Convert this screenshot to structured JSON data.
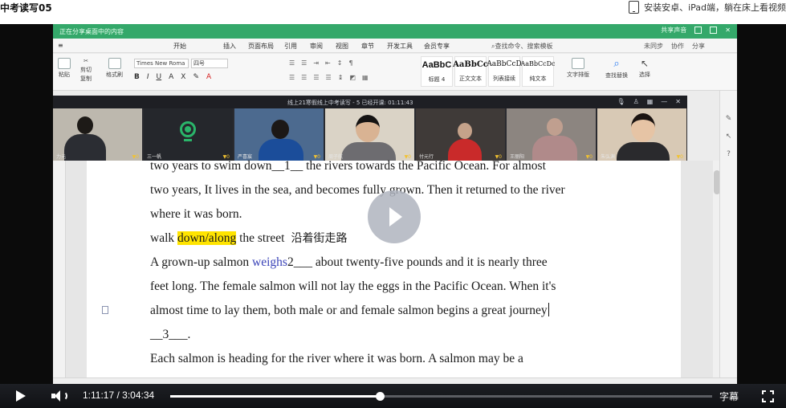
{
  "header": {
    "page_title": "中考读写05",
    "install_text": "安装安卓、iPad端，躺在床上看视频"
  },
  "wps": {
    "share_title": "正在分享桌面中的内容",
    "title_right": [
      "共享声音"
    ],
    "tabs": [
      "开始",
      "插入",
      "页面布局",
      "引用",
      "审阅",
      "视图",
      "章节",
      "开发工具",
      "会员专享"
    ],
    "active_tab": "开始",
    "search_cmd": "查找命令、搜索模板",
    "ribbon_right": [
      "未同步",
      "协作",
      "分享"
    ],
    "font_name": "Times New Roma",
    "font_size": "四号",
    "clipboard": [
      "粘贴",
      "剪切",
      "复制",
      "格式刷"
    ],
    "styles": [
      {
        "sample": "AaBbC",
        "name": "标题 4"
      },
      {
        "sample": "AaBbCc",
        "name": "正文文本"
      },
      {
        "sample": "AaBbCcD",
        "name": "列表接续"
      },
      {
        "sample": "AaBbCcDc",
        "name": "纯文本"
      }
    ],
    "tools": [
      "文字排版",
      "查找替换",
      "选择"
    ]
  },
  "meeting": {
    "title": "线上21寒假线上中考读写 - 5  已经开课: 01:11:43",
    "participants": [
      {
        "name": "力元"
      },
      {
        "name": "三一帆"
      },
      {
        "name": "严喜宸"
      },
      {
        "name": "周子航"
      },
      {
        "name": "付元行"
      },
      {
        "name": "王丽阳"
      },
      {
        "name": "朱弘渊"
      }
    ]
  },
  "document": {
    "lines": [
      {
        "parts": [
          {
            "t": "two years to swim down__1__ the rivers towards the Pacific Ocean. For almost"
          }
        ]
      },
      {
        "parts": [
          {
            "t": "two years, It lives in the sea, and becomes fully grown. Then it returned to the river"
          }
        ]
      },
      {
        "parts": [
          {
            "t": "where it was born."
          }
        ]
      },
      {
        "parts": [
          {
            "t": "walk "
          },
          {
            "t": "down/along",
            "hl": true
          },
          {
            "t": " the street"
          },
          {
            "t": "沿着街走路",
            "cjk": true
          }
        ]
      },
      {
        "parts": [
          {
            "t": "A grown-up salmon "
          },
          {
            "t": "weighs",
            "blue": true
          },
          {
            "t": "2___ about twenty-five pounds and it is nearly three"
          }
        ]
      },
      {
        "parts": [
          {
            "t": "feet long. The female salmon will not lay the eggs in the Pacific Ocean. When it's"
          }
        ]
      },
      {
        "parts": [
          {
            "t": "almost time to lay them, both male or and female salmon begins a great journey"
          }
        ],
        "cursor": true
      },
      {
        "parts": [
          {
            "t": "__3___."
          }
        ]
      },
      {
        "parts": [
          {
            "t": "Each salmon is heading for the river where it was born. A salmon may be a"
          }
        ]
      }
    ]
  },
  "player": {
    "current_time": "1:11:17",
    "total_time": "3:04:34",
    "time_separator": " / ",
    "progress_fraction": 0.386,
    "subtitles_label": "字幕"
  },
  "colors": {
    "wps_green": "#34a86a",
    "highlight": "#ffe400",
    "tab_blue": "#2e7ef2"
  }
}
